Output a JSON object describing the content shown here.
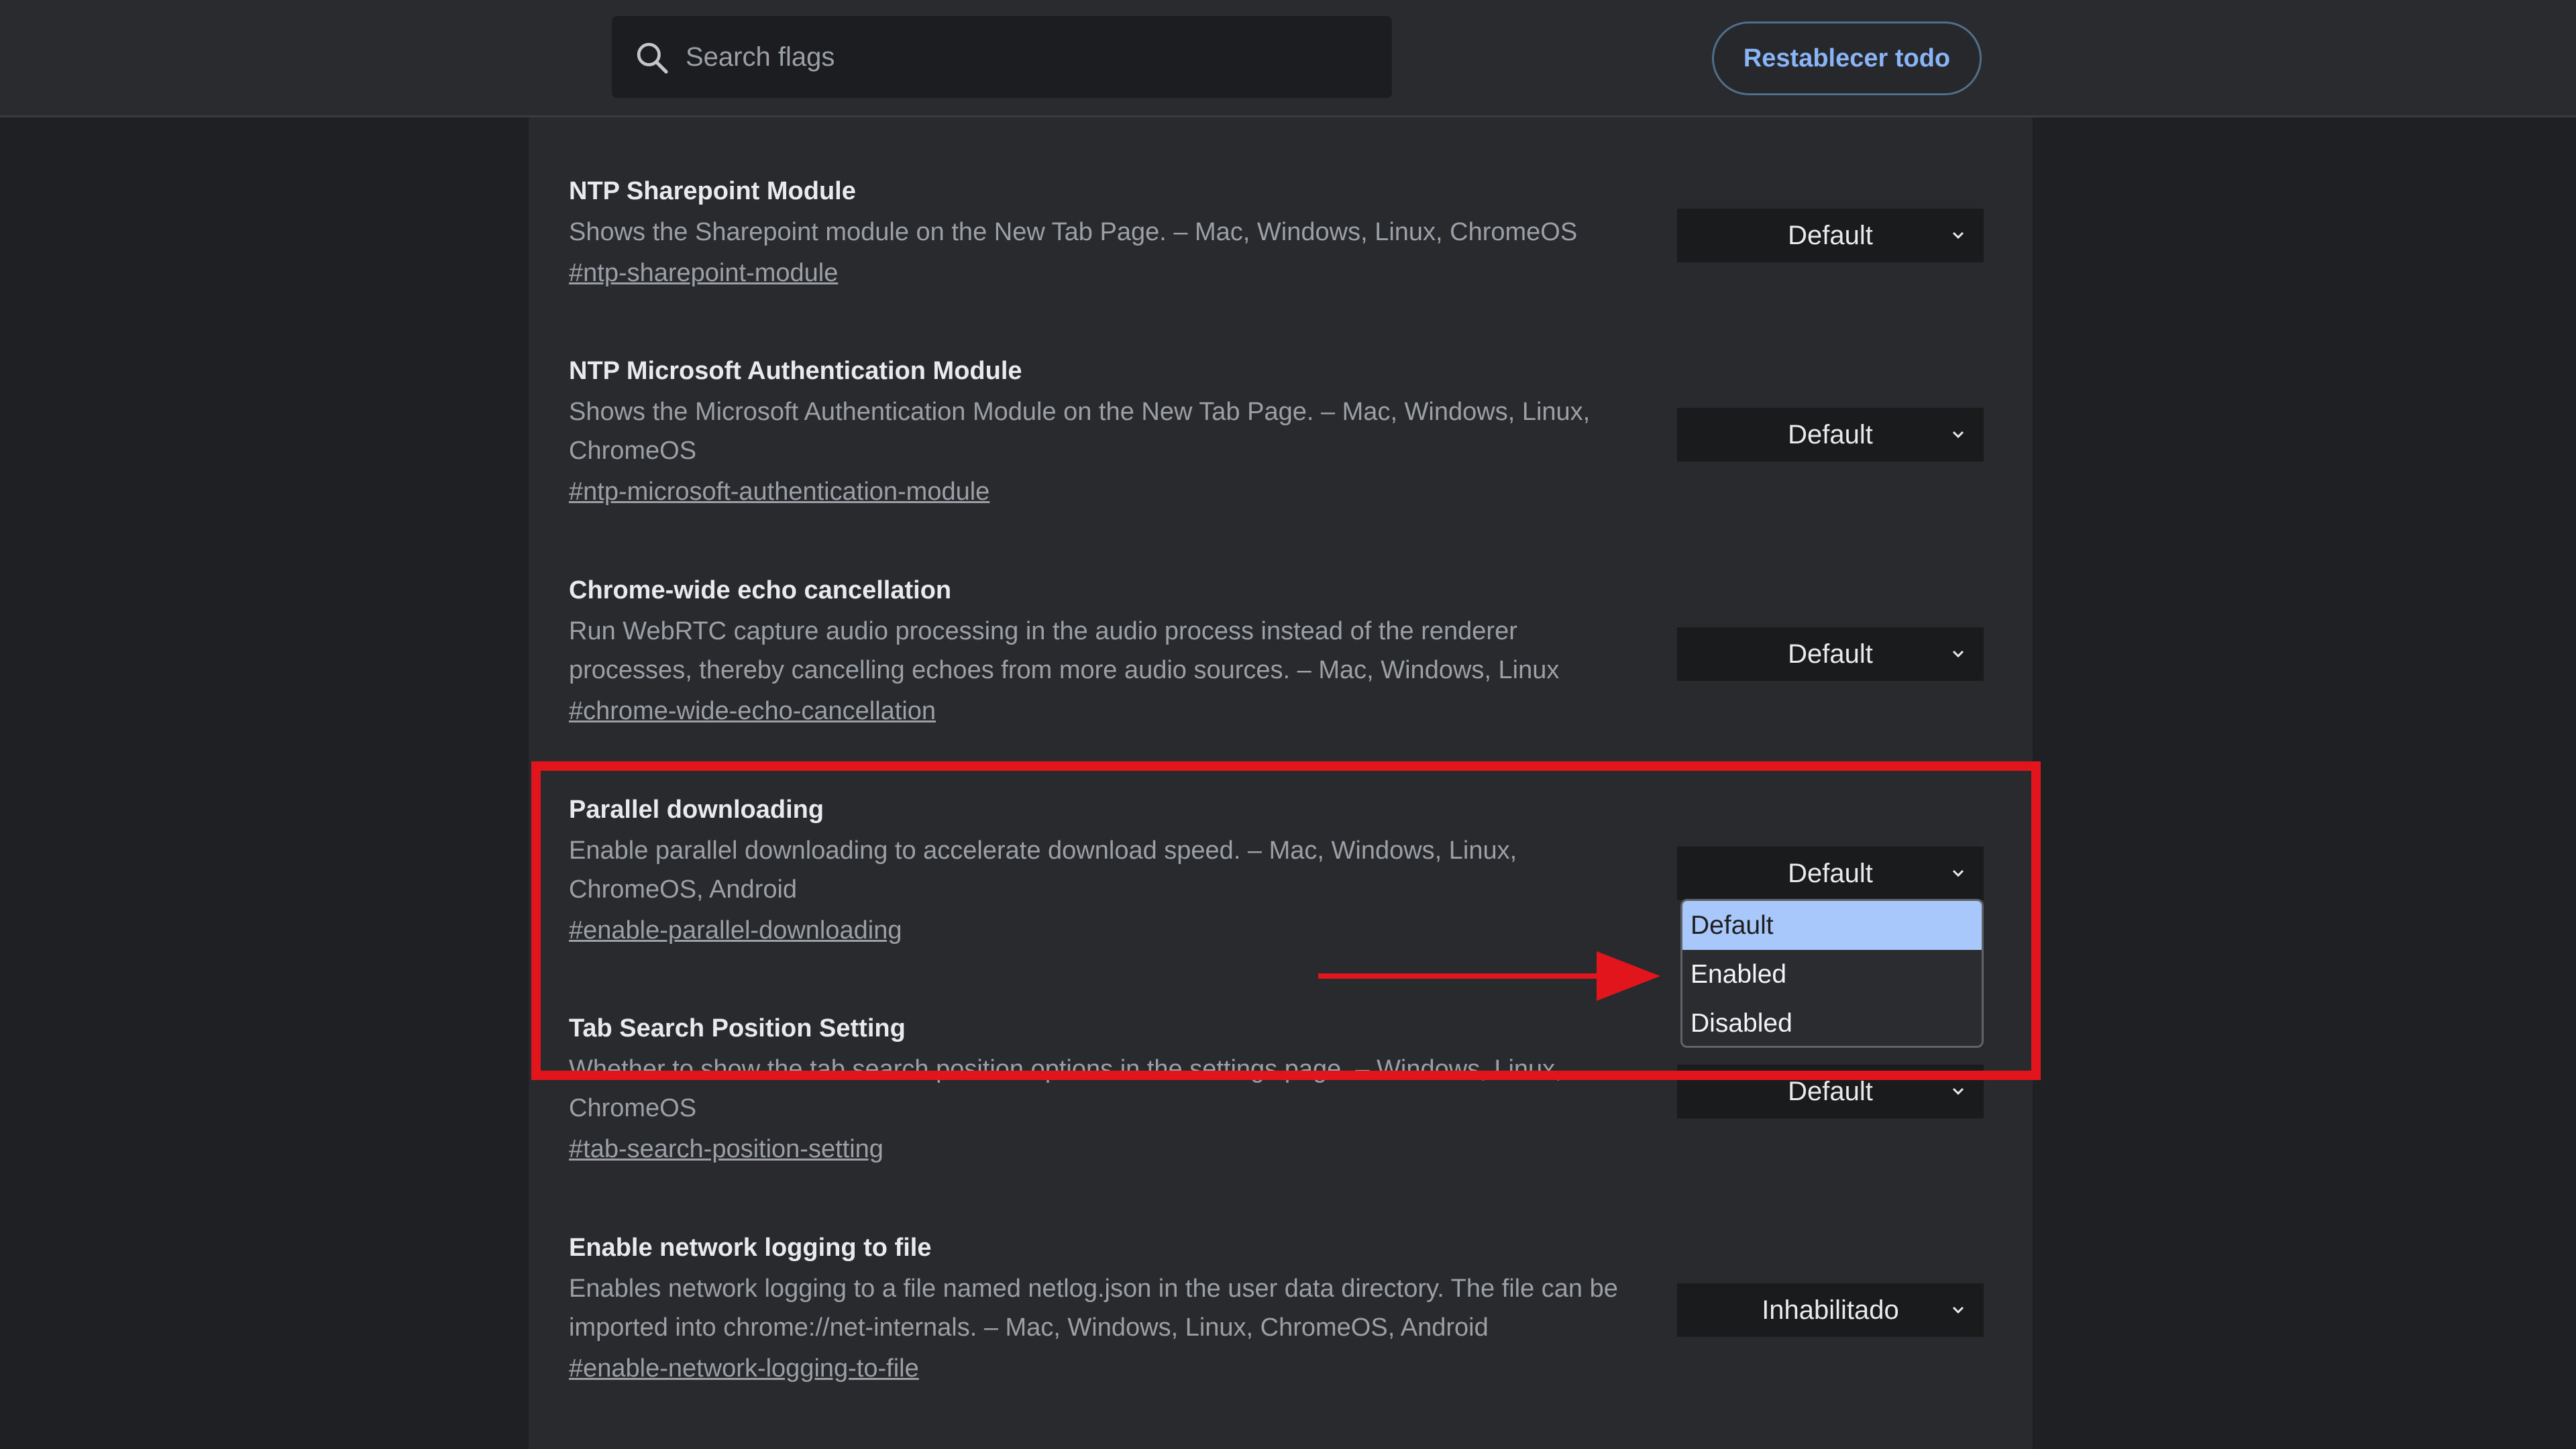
{
  "header": {
    "search_placeholder": "Search flags",
    "reset_label": "Restablecer todo"
  },
  "flags": [
    {
      "title": "NTP Sharepoint Module",
      "description": "Shows the Sharepoint module on the New Tab Page. – Mac, Windows, Linux, ChromeOS",
      "link": "#ntp-sharepoint-module",
      "value": "Default"
    },
    {
      "title": "NTP Microsoft Authentication Module",
      "description": "Shows the Microsoft Authentication Module on the New Tab Page. – Mac, Windows, Linux, ChromeOS",
      "link": "#ntp-microsoft-authentication-module",
      "value": "Default"
    },
    {
      "title": "Chrome-wide echo cancellation",
      "description": "Run WebRTC capture audio processing in the audio process instead of the renderer processes, thereby cancelling echoes from more audio sources. – Mac, Windows, Linux",
      "link": "#chrome-wide-echo-cancellation",
      "value": "Default"
    },
    {
      "title": "Parallel downloading",
      "description": "Enable parallel downloading to accelerate download speed. – Mac, Windows, Linux, ChromeOS, Android",
      "link": "#enable-parallel-downloading",
      "value": "Default"
    },
    {
      "title": "Tab Search Position Setting",
      "description": "Whether to show the tab search position options in the settings page. – Windows, Linux, ChromeOS",
      "link": "#tab-search-position-setting",
      "value": "Default"
    },
    {
      "title": "Enable network logging to file",
      "description": "Enables network logging to a file named netlog.json in the user data directory. The file can be imported into chrome://net-internals. – Mac, Windows, Linux, ChromeOS, Android",
      "link": "#enable-network-logging-to-file",
      "value": "Inhabilitado"
    }
  ],
  "dropdown": {
    "options": [
      "Default",
      "Enabled",
      "Disabled"
    ],
    "selected": "Default"
  },
  "annotation": {
    "highlight_color": "#e2151d",
    "arrow_color": "#e2151d"
  },
  "colors": {
    "background": "#1f2023",
    "panel": "#292a2d",
    "accent": "#8ab4f8",
    "selected_option": "#a8c7fa"
  }
}
